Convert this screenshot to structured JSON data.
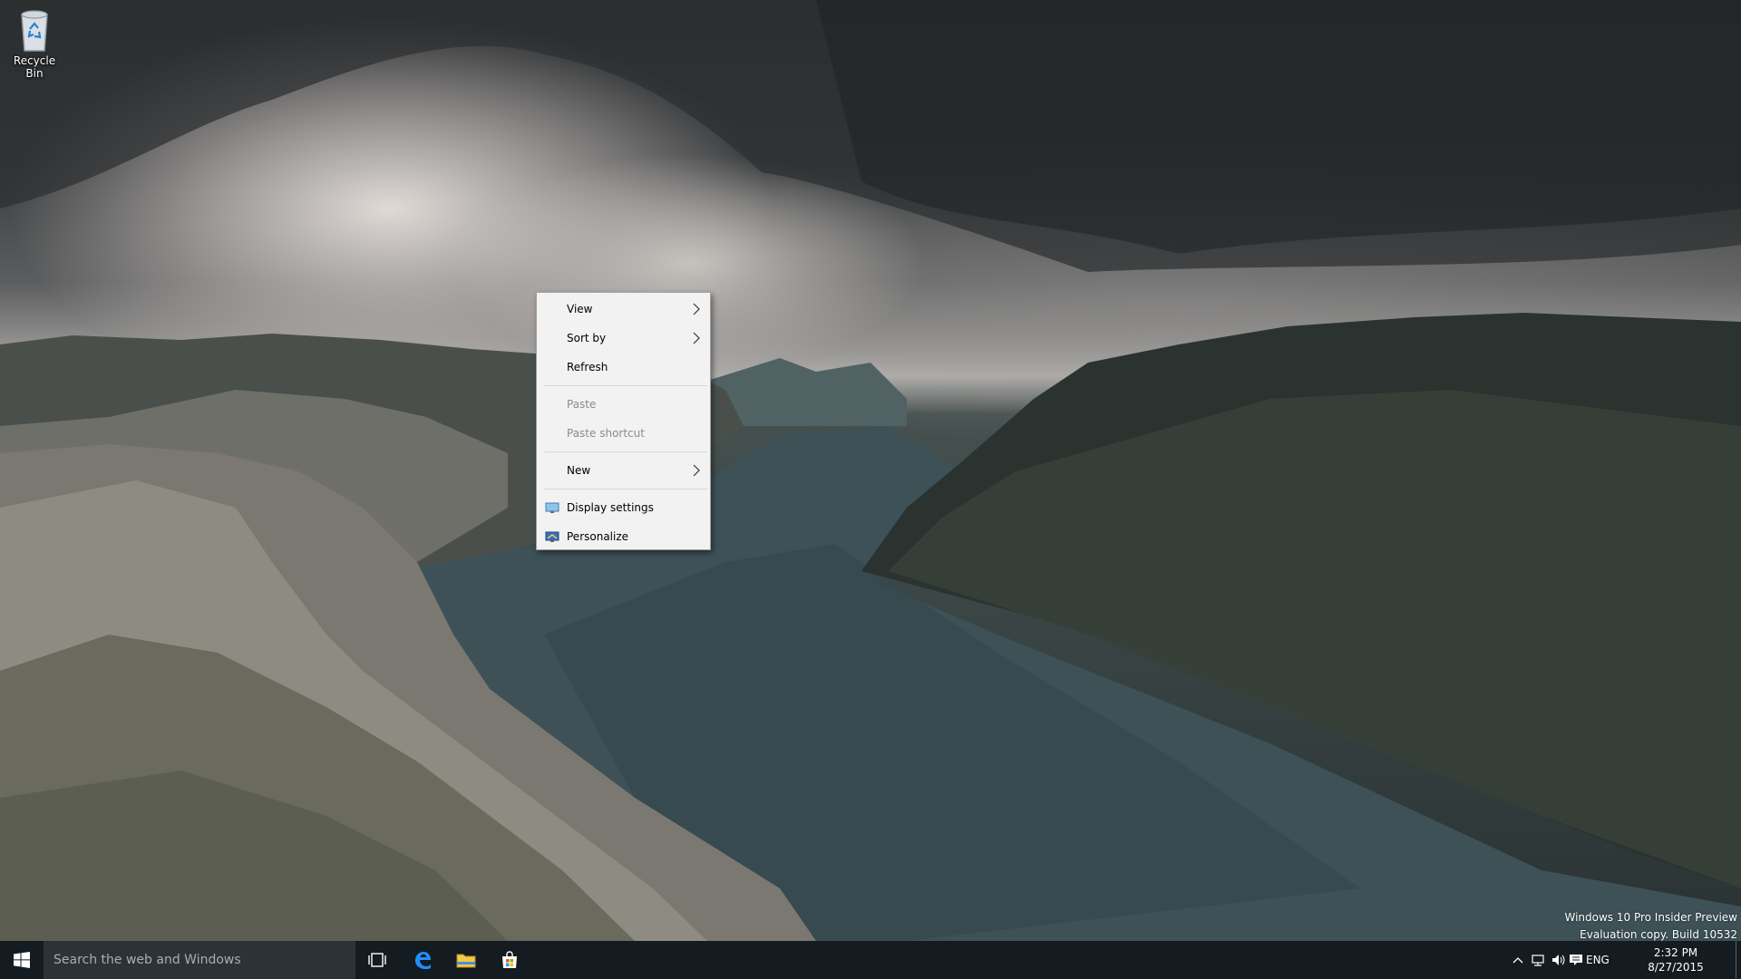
{
  "desktop": {
    "icons": [
      {
        "label": "Recycle Bin",
        "icon": "recycle-bin-icon"
      }
    ]
  },
  "context_menu": {
    "items": [
      {
        "label": "View",
        "submenu": true,
        "enabled": true
      },
      {
        "label": "Sort by",
        "submenu": true,
        "enabled": true
      },
      {
        "label": "Refresh",
        "submenu": false,
        "enabled": true
      },
      {
        "label": "Paste",
        "submenu": false,
        "enabled": false
      },
      {
        "label": "Paste shortcut",
        "submenu": false,
        "enabled": false
      },
      {
        "label": "New",
        "submenu": true,
        "enabled": true
      },
      {
        "label": "Display settings",
        "icon": "display-settings-icon",
        "enabled": true
      },
      {
        "label": "Personalize",
        "icon": "personalize-icon",
        "enabled": true
      }
    ]
  },
  "watermark": {
    "line1": "Windows 10 Pro Insider Preview",
    "line2": "Evaluation copy. Build 10532"
  },
  "taskbar": {
    "start_icon": "windows-logo-icon",
    "search_placeholder": "Search the web and Windows",
    "pinned": [
      {
        "name": "task-view",
        "icon": "task-view-icon"
      },
      {
        "name": "edge",
        "icon": "edge-icon",
        "color": "#1e90ff"
      },
      {
        "name": "file-explorer",
        "icon": "folder-icon",
        "color": "#f2c94c"
      },
      {
        "name": "store",
        "icon": "store-icon"
      }
    ],
    "tray": {
      "language": "ENG",
      "time": "2:32 PM",
      "date": "8/27/2015"
    }
  },
  "colors": {
    "taskbar_bg": "#141c22",
    "search_bg": "#2b3238",
    "menu_bg": "#f2f2f2",
    "menu_disabled_text": "#8c8c8c"
  }
}
